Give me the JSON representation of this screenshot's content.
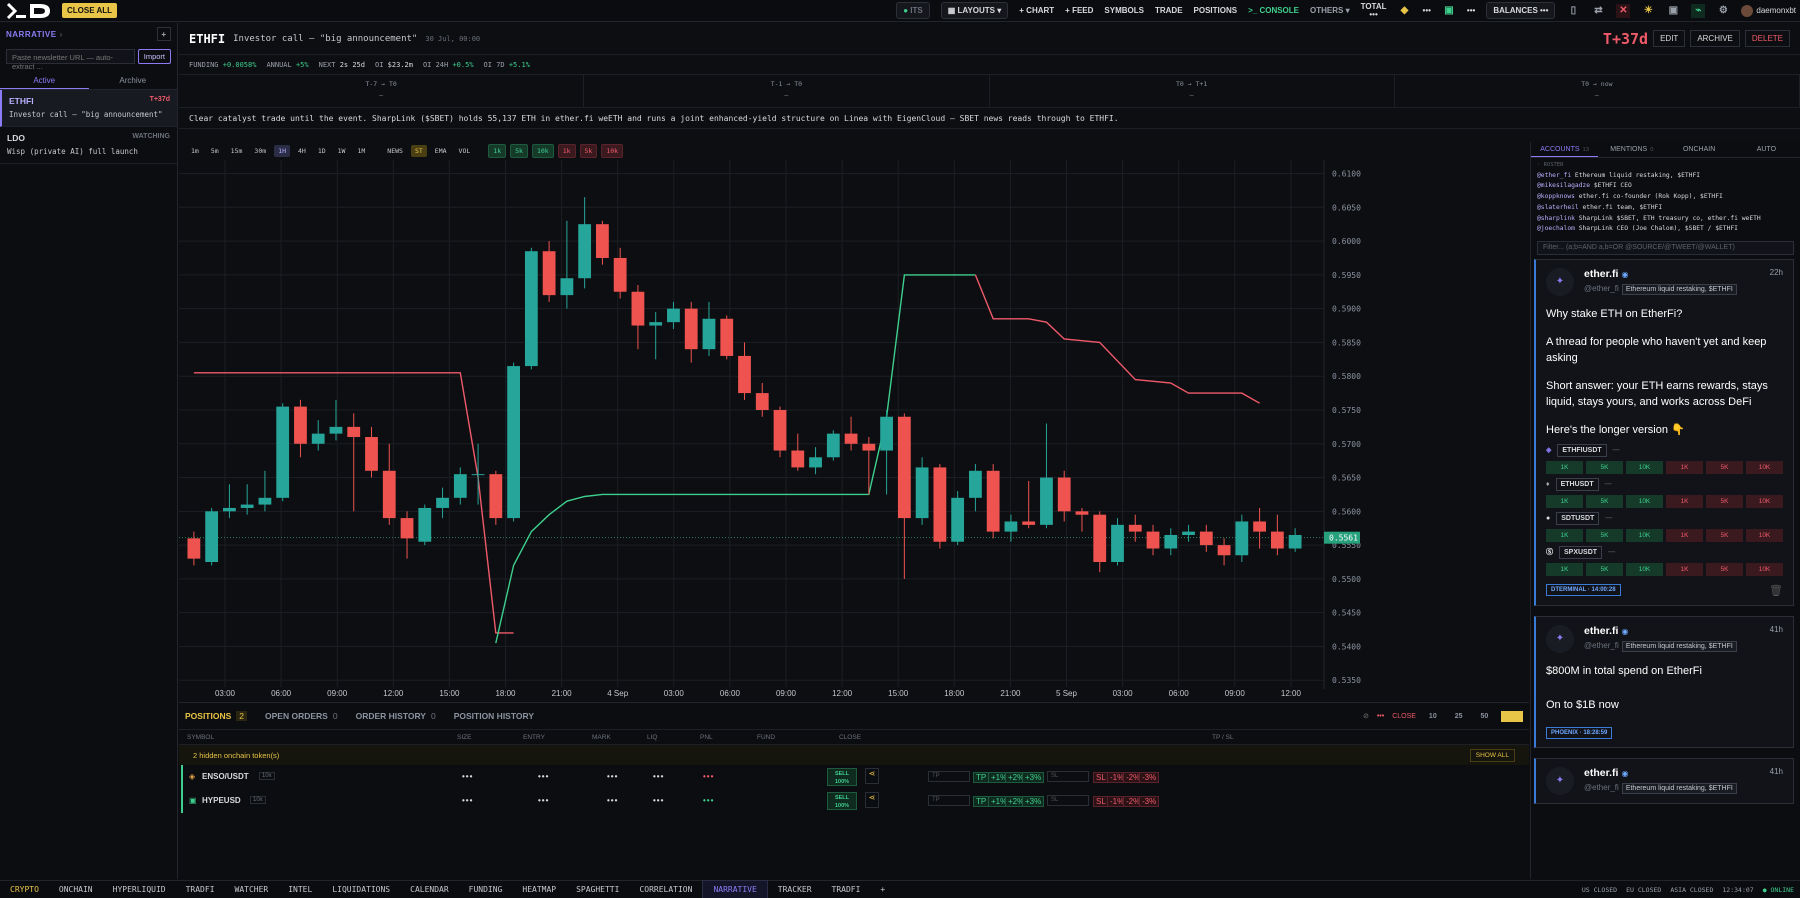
{
  "topbar": {
    "close_all": "CLOSE ALL",
    "ping": "ITS",
    "layouts": "LAYOUTS",
    "chart": "+ CHART",
    "feed": "+ FEED",
    "symbols": "SYMBOLS",
    "trade": "TRADE",
    "positions": "POSITIONS",
    "console": "CONSOLE",
    "others": "OTHERS",
    "total": "TOTAL",
    "balances": "BALANCES",
    "user": "daemonxbt"
  },
  "sidebar": {
    "title": "NARRATIVE",
    "import_placeholder": "Paste newsletter URL — auto-extract ...",
    "import_btn": "Import",
    "tabs": [
      "Active",
      "Archive"
    ],
    "items": [
      {
        "sym": "ETHFI",
        "tag": "T+37d",
        "desc": "Investor call — \"big announcement\""
      },
      {
        "sym": "LDO",
        "tag": "WATCHING",
        "desc": "Wisp (private AI) full launch"
      }
    ]
  },
  "header": {
    "symbol": "ETHFI",
    "subtitle": "Investor call — \"big announcement\"",
    "date": "30 Jul, 00:00",
    "tplus": "T+37d",
    "edit": "EDIT",
    "archive": "ARCHIVE",
    "delete": "DELETE"
  },
  "stats": {
    "funding_l": "FUNDING",
    "funding": "+0.0058%",
    "annual_l": "ANNUAL",
    "annual": "+5%",
    "next_l": "NEXT",
    "next": "2s 25d",
    "oi_l": "OI",
    "oi": "$23.2m",
    "oi24_l": "OI 24H",
    "oi24": "+0.5%",
    "oi7_l": "OI 7D",
    "oi7": "+5.1%"
  },
  "timeline": [
    {
      "l": "T-7 → T0",
      "v": "—"
    },
    {
      "l": "T-1 → T0",
      "v": "—"
    },
    {
      "l": "T0 → T+1",
      "v": "—"
    },
    {
      "l": "T0 → now",
      "v": "—"
    }
  ],
  "notes": "Clear catalyst trade until the event. SharpLink ($SBET) holds 55,137 ETH in ether.fi weETH and runs a joint enhanced-yield structure on Linea with EigenCloud — SBET news reads through to ETHFI.",
  "toolbar": {
    "tfs": [
      "1m",
      "5m",
      "15m",
      "30m",
      "1H",
      "4H",
      "1D",
      "1W",
      "1M"
    ],
    "active_tf": "1H",
    "ind": [
      "NEWS",
      "ST",
      "EMA",
      "VOL"
    ],
    "buys": [
      "1k",
      "5k",
      "10k"
    ],
    "sells": [
      "1k",
      "5k",
      "10k"
    ]
  },
  "chart_data": {
    "type": "candlestick",
    "price_label": "0.5561",
    "y_ticks": [
      "0.6100",
      "0.6050",
      "0.6000",
      "0.5950",
      "0.5900",
      "0.5850",
      "0.5800",
      "0.5750",
      "0.5700",
      "0.5650",
      "0.5600",
      "0.5550",
      "0.5500",
      "0.5450",
      "0.5400",
      "0.5350"
    ],
    "ylim": [
      0.534,
      0.612
    ],
    "x_ticks": [
      "03:00",
      "06:00",
      "09:00",
      "12:00",
      "15:00",
      "18:00",
      "21:00",
      "4 Sep",
      "03:00",
      "06:00",
      "09:00",
      "12:00",
      "15:00",
      "18:00",
      "21:00",
      "5 Sep",
      "03:00",
      "06:00",
      "09:00",
      "12:00"
    ],
    "candles": [
      [
        0.556,
        0.553,
        0.557,
        0.552
      ],
      [
        0.5525,
        0.56,
        0.5605,
        0.552
      ],
      [
        0.56,
        0.5605,
        0.564,
        0.559
      ],
      [
        0.5605,
        0.561,
        0.564,
        0.5595
      ],
      [
        0.561,
        0.562,
        0.566,
        0.56
      ],
      [
        0.562,
        0.5755,
        0.576,
        0.5615
      ],
      [
        0.5755,
        0.57,
        0.5765,
        0.568
      ],
      [
        0.57,
        0.5715,
        0.5735,
        0.569
      ],
      [
        0.5715,
        0.5725,
        0.5765,
        0.5705
      ],
      [
        0.5725,
        0.571,
        0.5745,
        0.56
      ],
      [
        0.571,
        0.566,
        0.5725,
        0.565
      ],
      [
        0.566,
        0.559,
        0.57,
        0.558
      ],
      [
        0.559,
        0.556,
        0.56,
        0.553
      ],
      [
        0.5555,
        0.5605,
        0.561,
        0.555
      ],
      [
        0.5605,
        0.562,
        0.5635,
        0.559
      ],
      [
        0.562,
        0.5655,
        0.5665,
        0.561
      ],
      [
        0.5655,
        0.5655,
        0.57,
        0.561
      ],
      [
        0.5655,
        0.559,
        0.566,
        0.558
      ],
      [
        0.559,
        0.5815,
        0.582,
        0.5585
      ],
      [
        0.5815,
        0.5985,
        0.599,
        0.581
      ],
      [
        0.5985,
        0.592,
        0.6,
        0.591
      ],
      [
        0.592,
        0.5945,
        0.603,
        0.59
      ],
      [
        0.5945,
        0.6025,
        0.6065,
        0.593
      ],
      [
        0.6025,
        0.5975,
        0.603,
        0.5965
      ],
      [
        0.5975,
        0.5925,
        0.599,
        0.5915
      ],
      [
        0.5925,
        0.5875,
        0.5935,
        0.584
      ],
      [
        0.5875,
        0.588,
        0.5895,
        0.5825
      ],
      [
        0.588,
        0.59,
        0.591,
        0.587
      ],
      [
        0.59,
        0.584,
        0.591,
        0.582
      ],
      [
        0.584,
        0.5885,
        0.591,
        0.583
      ],
      [
        0.5885,
        0.583,
        0.589,
        0.5825
      ],
      [
        0.583,
        0.5775,
        0.585,
        0.5765
      ],
      [
        0.5775,
        0.575,
        0.579,
        0.574
      ],
      [
        0.575,
        0.569,
        0.5755,
        0.568
      ],
      [
        0.569,
        0.5665,
        0.5715,
        0.566
      ],
      [
        0.5665,
        0.568,
        0.5695,
        0.5655
      ],
      [
        0.568,
        0.5715,
        0.572,
        0.5675
      ],
      [
        0.5715,
        0.57,
        0.574,
        0.569
      ],
      [
        0.57,
        0.569,
        0.571,
        0.5625
      ],
      [
        0.569,
        0.574,
        0.575,
        0.5625
      ],
      [
        0.574,
        0.559,
        0.5745,
        0.55
      ],
      [
        0.559,
        0.5665,
        0.568,
        0.558
      ],
      [
        0.5665,
        0.5555,
        0.567,
        0.5545
      ],
      [
        0.5555,
        0.562,
        0.563,
        0.555
      ],
      [
        0.562,
        0.566,
        0.567,
        0.56
      ],
      [
        0.566,
        0.557,
        0.567,
        0.556
      ],
      [
        0.557,
        0.5585,
        0.5595,
        0.5555
      ],
      [
        0.5585,
        0.558,
        0.5645,
        0.5575
      ],
      [
        0.558,
        0.565,
        0.573,
        0.5575
      ],
      [
        0.565,
        0.56,
        0.566,
        0.5585
      ],
      [
        0.56,
        0.5595,
        0.5605,
        0.557
      ],
      [
        0.5595,
        0.5525,
        0.56,
        0.551
      ],
      [
        0.5525,
        0.558,
        0.559,
        0.552
      ],
      [
        0.558,
        0.557,
        0.5595,
        0.5555
      ],
      [
        0.557,
        0.5545,
        0.558,
        0.5535
      ],
      [
        0.5545,
        0.5565,
        0.5575,
        0.5535
      ],
      [
        0.5565,
        0.557,
        0.558,
        0.5555
      ],
      [
        0.557,
        0.555,
        0.558,
        0.554
      ],
      [
        0.555,
        0.5535,
        0.556,
        0.552
      ],
      [
        0.5535,
        0.5585,
        0.5595,
        0.5525
      ],
      [
        0.5585,
        0.557,
        0.5605,
        0.5545
      ],
      [
        0.557,
        0.5545,
        0.5595,
        0.5535
      ],
      [
        0.5545,
        0.5565,
        0.5575,
        0.554
      ]
    ],
    "supertrend_red": [
      [
        0,
        0.5805
      ],
      [
        15,
        0.5805
      ],
      [
        16,
        0.565
      ],
      [
        17,
        0.542
      ],
      [
        18,
        0.542
      ]
    ],
    "supertrend_green": [
      [
        17,
        0.5405
      ],
      [
        18,
        0.552
      ],
      [
        19,
        0.557
      ],
      [
        20,
        0.5595
      ],
      [
        21,
        0.5615
      ],
      [
        22,
        0.5622
      ],
      [
        23,
        0.5625
      ],
      [
        38,
        0.5625
      ],
      [
        39,
        0.574
      ],
      [
        40,
        0.595
      ],
      [
        42,
        0.595
      ],
      [
        43,
        0.595
      ],
      [
        44,
        0.595
      ]
    ],
    "supertrend_red2": [
      [
        44,
        0.595
      ],
      [
        45,
        0.5885
      ],
      [
        47,
        0.5885
      ],
      [
        48,
        0.588
      ],
      [
        49,
        0.5855
      ],
      [
        51,
        0.585
      ],
      [
        53,
        0.5795
      ],
      [
        55,
        0.579
      ],
      [
        56,
        0.5775
      ],
      [
        59,
        0.5775
      ],
      [
        60,
        0.576
      ]
    ]
  },
  "positions": {
    "tabs": [
      {
        "l": "POSITIONS",
        "c": "2"
      },
      {
        "l": "OPEN ORDERS",
        "c": "0"
      },
      {
        "l": "ORDER HISTORY",
        "c": "0"
      },
      {
        "l": "POSITION HISTORY",
        "c": ""
      }
    ],
    "close": "CLOSE",
    "sizes": [
      "10",
      "25",
      "50",
      "100"
    ],
    "cols": [
      "SYMBOL",
      "SIZE",
      "ENTRY",
      "MARK",
      "LIQ",
      "PNL",
      "FUND",
      "CLOSE",
      "TP / SL"
    ],
    "hidden": "2 hidden onchain token(s)",
    "show_all": "SHOW ALL",
    "rows": [
      {
        "sym": "ENSO/USDT",
        "lev": "10x"
      },
      {
        "sym": "HYPEUSD",
        "lev": "10x"
      }
    ],
    "sell": "SELL",
    "sell_pct": "100%",
    "tp": "TP",
    "sl": "SL",
    "tp_chips": [
      "+1%",
      "+2%",
      "+3%"
    ],
    "sl_chips": [
      "-1%",
      "-2%",
      "-3%"
    ]
  },
  "rpanel": {
    "tabs": [
      {
        "l": "ACCOUNTS",
        "c": "13"
      },
      {
        "l": "MENTIONS",
        "c": "0"
      },
      {
        "l": "ONCHAIN",
        "c": ""
      },
      {
        "l": "AUTO",
        "c": ""
      }
    ],
    "roster_label": "ROSTER",
    "roster": [
      {
        "h": "@ether_fi",
        "d": "Ethereum liquid restaking, $ETHFI"
      },
      {
        "h": "@mikesilagadze",
        "d": "$ETHFI CEO"
      },
      {
        "h": "@koppknows",
        "d": "ether.fi co-founder (Rok Kopp), $ETHFI"
      },
      {
        "h": "@slaterheil",
        "d": "ether.fi team, $ETHFI"
      },
      {
        "h": "@sharplink",
        "d": "SharpLink $SBET, ETH treasury co, ether.fi weETH"
      },
      {
        "h": "@joechalom",
        "d": "SharpLink CEO (Joe Chalom), $SBET / $ETHFI"
      }
    ],
    "filter": "Filter... (a;b=AND a,b=OR @SOURCE/@TWEET/@WALLET)",
    "tweets": [
      {
        "name": "ether.fi",
        "handle": "@ether_fi",
        "tag": "Ethereum liquid restaking, $ETHFI",
        "time": "22h",
        "body": [
          "Why stake ETH on EtherFi?",
          "A thread for people who haven't yet and keep asking",
          "Short answer: your ETH earns rewards, stays liquid, stays yours, and works across DeFi",
          "Here's the longer version 👇"
        ],
        "tickers": [
          "ETHFIUSDT",
          "ETHUSDT",
          "SDTUSDT",
          "SPXUSDT"
        ],
        "src": "DTERMINAL · 14:00:28"
      },
      {
        "name": "ether.fi",
        "handle": "@ether_fi",
        "tag": "Ethereum liquid restaking, $ETHFI",
        "time": "41h",
        "body": [
          "$800M in total spend on EtherFi",
          "On to $1B now"
        ],
        "tickers": [],
        "src": "PHOENIX · 18:28:59"
      },
      {
        "name": "ether.fi",
        "handle": "@ether_fi",
        "tag": "Ethereum liquid restaking, $ETHFI",
        "time": "41h",
        "body": [],
        "tickers": [],
        "src": ""
      }
    ],
    "kb": [
      "1K",
      "5K",
      "10K",
      "1K",
      "5K",
      "10K"
    ]
  },
  "bottombar": {
    "tabs": [
      "CRYPTO",
      "ONCHAIN",
      "HYPERLIQUID",
      "TRADFI",
      "WATCHER",
      "INTEL",
      "LIQUIDATIONS",
      "CALENDAR",
      "FUNDING",
      "HEATMAP",
      "SPAGHETTI",
      "CORRELATION",
      "NARRATIVE",
      "TRACKER",
      "TRADFI",
      "+"
    ],
    "status": [
      "US CLOSED",
      "EU CLOSED",
      "ASIA CLOSED",
      "12:34:07",
      "ONLINE"
    ]
  }
}
